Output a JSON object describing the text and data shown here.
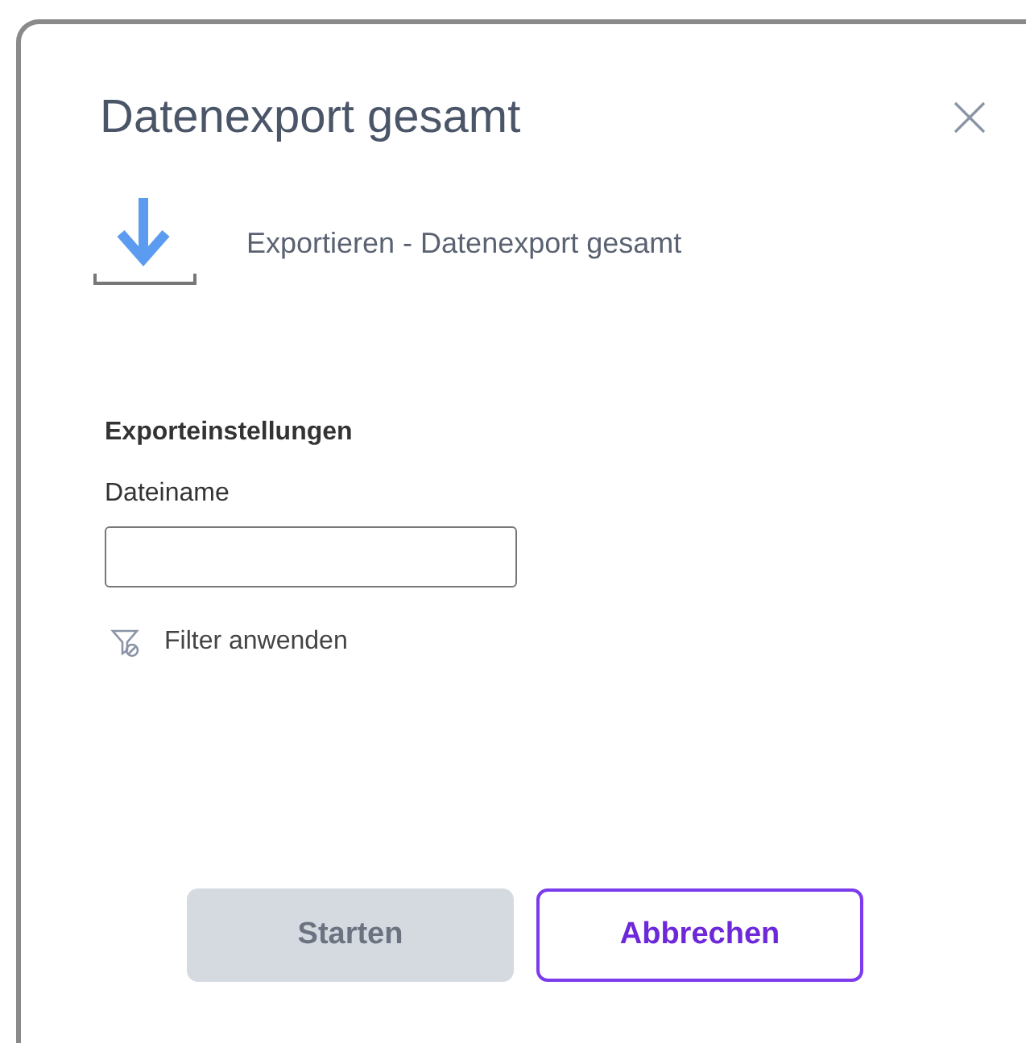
{
  "dialog": {
    "title": "Datenexport gesamt",
    "subtitle": "Exportieren - Datenexport gesamt"
  },
  "section_title": "Exporteinstellungen",
  "filename_field": {
    "label": "Dateiname"
  },
  "filter_link": {
    "label": "Filter anwenden"
  },
  "buttons": [
    {
      "label": "Starten",
      "kind": "primary",
      "disabled": true
    },
    {
      "label": "Abbrechen",
      "kind": "secondary",
      "disabled": false
    }
  ]
}
